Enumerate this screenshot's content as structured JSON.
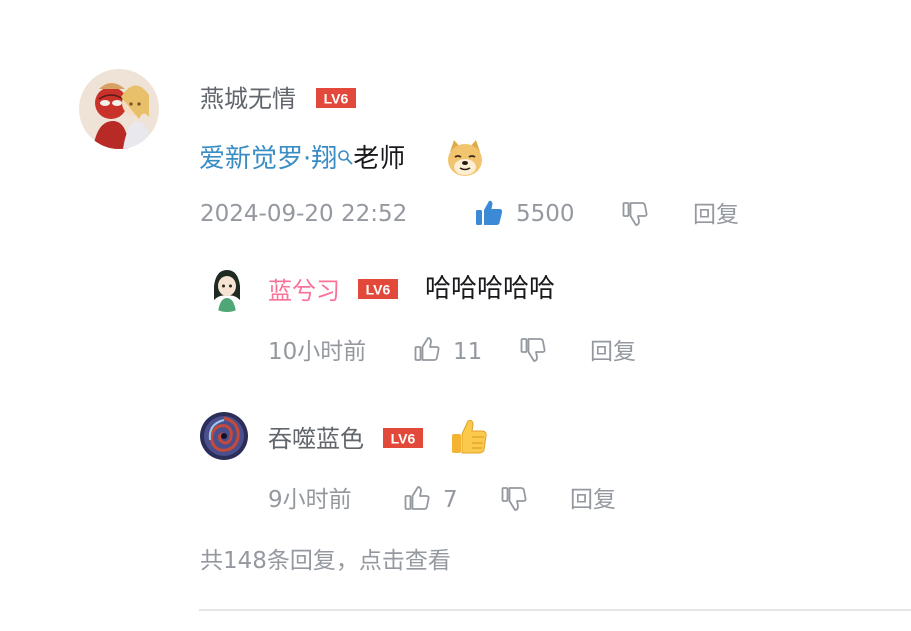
{
  "comment": {
    "avatar_icon": "avatar-spiderman-duo",
    "username": "燕城无情",
    "level": "LV6",
    "mention": "爱新觉罗·翔",
    "text": "老师",
    "emoji": "doge-emoji",
    "timestamp": "2024-09-20 22:52",
    "like_count": "5500",
    "liked": true,
    "reply_label": "回复"
  },
  "replies": [
    {
      "username": "蓝兮习",
      "level": "LV6",
      "text": "哈哈哈哈哈",
      "time": "10小时前",
      "like_count": "11",
      "reply_label": "回复",
      "name_color": "#fb7299"
    },
    {
      "username": "吞噬蓝色",
      "level": "LV6",
      "emoji": "thumbs-up-emoji",
      "time": "9小时前",
      "like_count": "7",
      "reply_label": "回复"
    }
  ],
  "more_replies": "共148条回复，点击查看",
  "colors": {
    "accent_like": "#00aeec",
    "mention": "#3a8cc4",
    "level_badge": "#e3493a",
    "meta": "#9499a0"
  }
}
